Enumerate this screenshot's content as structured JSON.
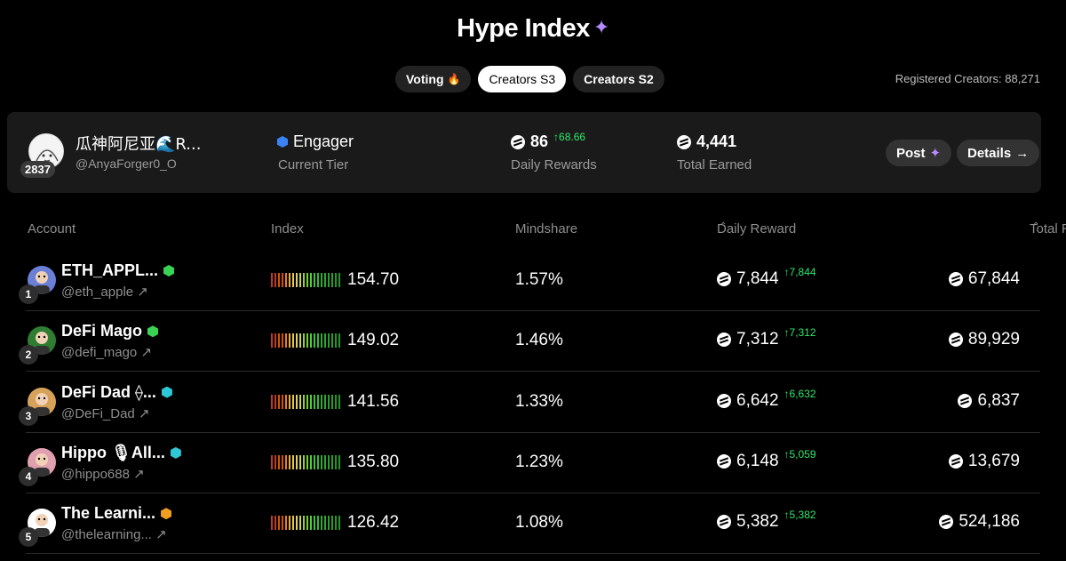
{
  "header": {
    "title": "Hype Index",
    "title_icon": "sparkle-icon"
  },
  "tabs": [
    {
      "label": "Voting",
      "icon": "fire-icon",
      "active": false
    },
    {
      "label": "Creators S3",
      "active": true
    },
    {
      "label": "Creators S2",
      "active": false
    }
  ],
  "registered_creators": "Registered Creators: 88,271",
  "me": {
    "rank": "2837",
    "name": "瓜神阿尼亚🌊R...",
    "handle": "@AnyaForger0_O",
    "tier": "Engager",
    "tier_label": "Current Tier",
    "daily_rewards": "86",
    "daily_delta": "↑68.66",
    "daily_label": "Daily Rewards",
    "total_earned": "4,441",
    "total_label": "Total Earned",
    "post_label": "Post",
    "details_label": "Details"
  },
  "table": {
    "columns": {
      "account": "Account",
      "index": "Index",
      "mindshare": "Mindshare",
      "daily": "Daily Reward",
      "total": "Total Reward"
    },
    "rows": [
      {
        "rank": "1",
        "name": "ETH_APPL...",
        "handle": "@eth_apple",
        "badge_color": "#39d353",
        "index": "154.70",
        "mindshare": "1.57%",
        "daily": "7,844",
        "delta": "↑7,844",
        "total": "67,844"
      },
      {
        "rank": "2",
        "name": "DeFi Mago",
        "handle": "@defi_mago",
        "badge_color": "#39d353",
        "index": "149.02",
        "mindshare": "1.46%",
        "daily": "7,312",
        "delta": "↑7,312",
        "total": "89,929"
      },
      {
        "rank": "3",
        "name": "DeFi Dad ⟠...",
        "handle": "@DeFi_Dad",
        "badge_color": "#2ec7d6",
        "index": "141.56",
        "mindshare": "1.33%",
        "daily": "6,642",
        "delta": "↑6,632",
        "total": "6,837"
      },
      {
        "rank": "4",
        "name": "Hippo 🎙All...",
        "handle": "@hippo688",
        "badge_color": "#2ec7d6",
        "index": "135.80",
        "mindshare": "1.23%",
        "daily": "6,148",
        "delta": "↑5,059",
        "total": "13,679"
      },
      {
        "rank": "5",
        "name": "The Learni...",
        "handle": "@thelearning...",
        "badge_color": "#f0a020",
        "index": "126.42",
        "mindshare": "1.08%",
        "daily": "5,382",
        "delta": "↑5,382",
        "total": "524,186"
      }
    ]
  }
}
